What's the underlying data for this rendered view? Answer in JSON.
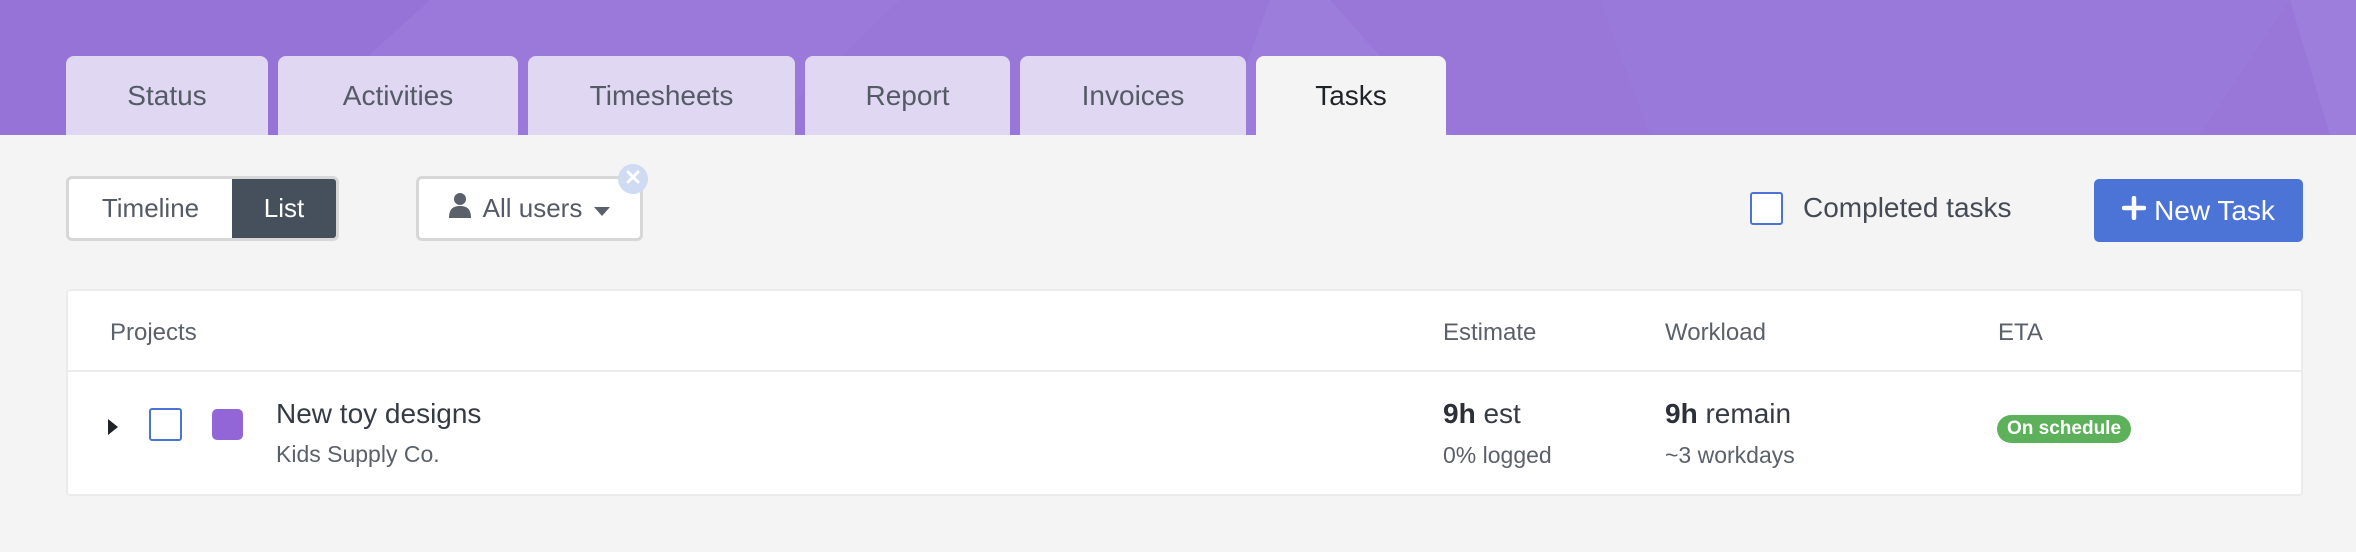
{
  "header": {
    "bg_color": "#9877d9",
    "tabs": [
      {
        "label": "Status",
        "active": false
      },
      {
        "label": "Activities",
        "active": false
      },
      {
        "label": "Timesheets",
        "active": false
      },
      {
        "label": "Report",
        "active": false
      },
      {
        "label": "Invoices",
        "active": false
      },
      {
        "label": "Tasks",
        "active": true
      }
    ]
  },
  "toolbar": {
    "view_toggle": {
      "timeline_label": "Timeline",
      "list_label": "List",
      "selected": "List"
    },
    "users_filter": {
      "icon": "user-icon",
      "label": "All users",
      "clear_icon": "close-icon"
    },
    "completed_tasks": {
      "label": "Completed tasks",
      "checked": false
    },
    "new_task": {
      "icon": "plus-icon",
      "label": "New Task",
      "color": "#4b74d6"
    }
  },
  "table": {
    "columns": {
      "projects": "Projects",
      "estimate": "Estimate",
      "workload": "Workload",
      "eta": "ETA"
    },
    "rows": [
      {
        "name": "New toy designs",
        "client": "Kids Supply Co.",
        "color": "#9366d8",
        "estimate_value": "9h",
        "estimate_suffix": " est",
        "logged": "0% logged",
        "workload_value": "9h",
        "workload_suffix": " remain",
        "workdays": "~3 workdays",
        "eta_status": "On schedule",
        "eta_color": "#5cb15a"
      }
    ]
  }
}
